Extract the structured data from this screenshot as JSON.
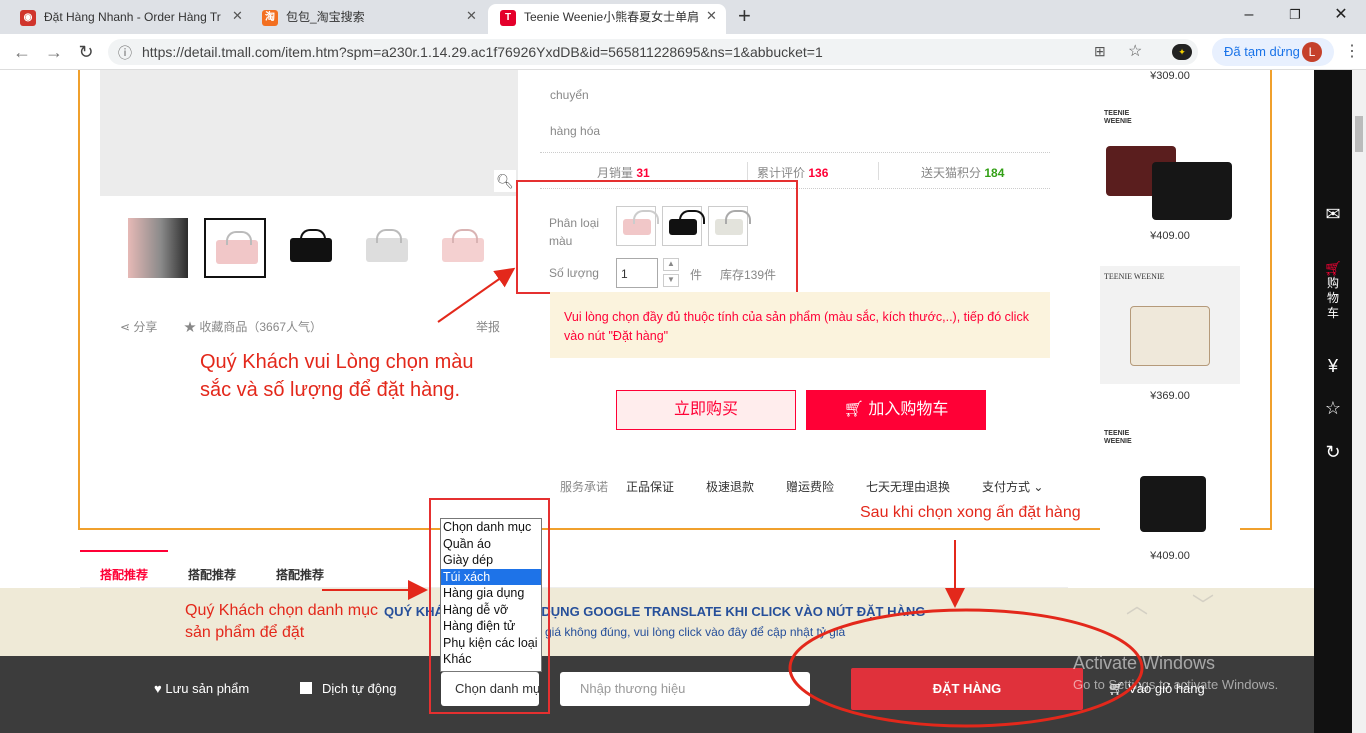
{
  "browser": {
    "tabs": [
      {
        "title": "Đặt Hàng Nhanh - Order Hàng Tr",
        "icon": "order-app-icon"
      },
      {
        "title": "包包_淘宝搜索",
        "icon": "taobao-icon"
      },
      {
        "title": "Teenie Weenie小熊春夏女士单肩",
        "icon": "tmall-icon"
      }
    ],
    "url": "https://detail.tmall.com/item.htm?spm=a230r.1.14.29.ac1f76926YxdDB&id=565811228695&ns=1&abbucket=1",
    "paused_label": "Đã tạm dừng",
    "avatar_letter": "L"
  },
  "product": {
    "meta_rows": [
      "chuyển",
      "hàng hóa"
    ],
    "stats": [
      {
        "label": "月销量",
        "value": "31"
      },
      {
        "label": "累计评价",
        "value": "136"
      },
      {
        "label": "送天猫积分",
        "value": "184"
      }
    ],
    "color_label": "Phân loại màu",
    "qty_label": "Số lượng",
    "qty_value": "1",
    "qty_unit": "件",
    "stock": "库存139件",
    "warning": "Vui lòng chọn đầy đủ thuộc tính của sản phẩm (màu sắc, kích thước,..), tiếp đó click vào nút \"Đặt hàng\"",
    "buy_now": "立即购买",
    "add_cart": "加入购物车",
    "services": [
      "服务承诺",
      "正品保证",
      "极速退款",
      "赠运费险",
      "七天无理由退换",
      "支付方式"
    ],
    "share": "分享",
    "favorite": "收藏商品",
    "fav_count": "（3667人气）",
    "report": "举报"
  },
  "tabs_below": [
    "搭配推荐",
    "搭配推荐",
    "搭配推荐"
  ],
  "right_column": {
    "prices": [
      "¥309.00",
      "¥409.00",
      "¥369.00",
      "¥409.00"
    ],
    "brand": "TEENIE WEENIE"
  },
  "sidebar": {
    "cart_label": "购物车"
  },
  "annotations": {
    "choose_color": "Quý Khách vui Lòng chọn màu sắc và số lượng để đặt hàng.",
    "choose_category": "Quý Khách chọn danh mục sản phẩm để đặt",
    "after_choose": "Sau khi chọn xong ấn đặt hàng"
  },
  "banner": {
    "title": "QUÝ KHÁCH KHÔNG SỬ DỤNG GOOGLE TRANSLATE KHI CLICK VÀO NÚT ĐẶT HÀNG",
    "sub": "giá không đúng, vui lòng click vào đây để cập nhật tỷ giá"
  },
  "category_dropdown": {
    "options": [
      "Chọn danh mục",
      "Quần áo",
      "Giày dép",
      "Túi xách",
      "Hàng gia dụng",
      "Hàng dễ vỡ",
      "Hàng điện tử",
      "Phụ kiện các loại",
      "Khác"
    ],
    "selected_index": 3,
    "closed_value": "Chọn danh mục"
  },
  "bottom_bar": {
    "save": "Lưu sản phẩm",
    "translate": "Dịch tự động",
    "note_placeholder": "Nhập thương hiệu",
    "order": "ĐẶT HÀNG",
    "cart": "Vào giỏ hàng"
  },
  "watermark": {
    "line1": "Activate Windows",
    "line2": "Go to Settings to activate Windows."
  },
  "colors": {
    "accent": "#ff0036",
    "annotation": "#e3281b",
    "orange_border": "#f0a02c"
  }
}
